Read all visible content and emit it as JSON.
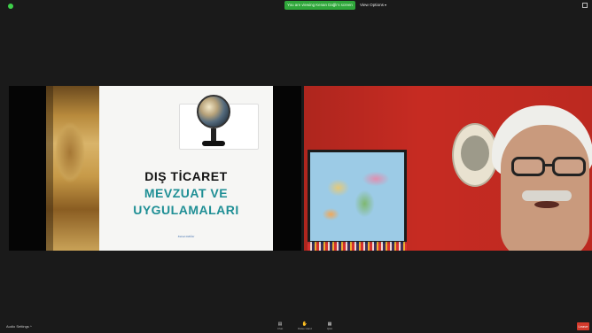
{
  "top_bar": {
    "sharing_banner": "You are viewing Kenan Dağlı's screen",
    "view_options_label": "View Options",
    "colors": {
      "sharing_banner_bg": "#2fa63a",
      "security_icon": "#3ecf4a"
    },
    "icons": [
      "shield-icon",
      "chevron-down-icon",
      "fullscreen-icon"
    ]
  },
  "slide": {
    "title_line1": "DIŞ TİCARET",
    "title_line2": "MEVZUAT VE",
    "title_line3": "UYGULAMALARI",
    "signature": "Kenan DAĞLI",
    "colors": {
      "title_primary": "#111111",
      "title_accent": "#1f8f95"
    }
  },
  "video": {
    "participant_visible": true,
    "wall_color": "#c62b22"
  },
  "bottom_bar": {
    "audio_settings_label": "Audio Settings",
    "tools": [
      {
        "label": "Chat",
        "icon": "chat-icon"
      },
      {
        "label": "Raise Hand",
        "icon": "hand-icon"
      },
      {
        "label": "Q&A",
        "icon": "qa-icon"
      }
    ],
    "leave_label": "Leave",
    "colors": {
      "leave_bg": "#d33a2c"
    }
  }
}
